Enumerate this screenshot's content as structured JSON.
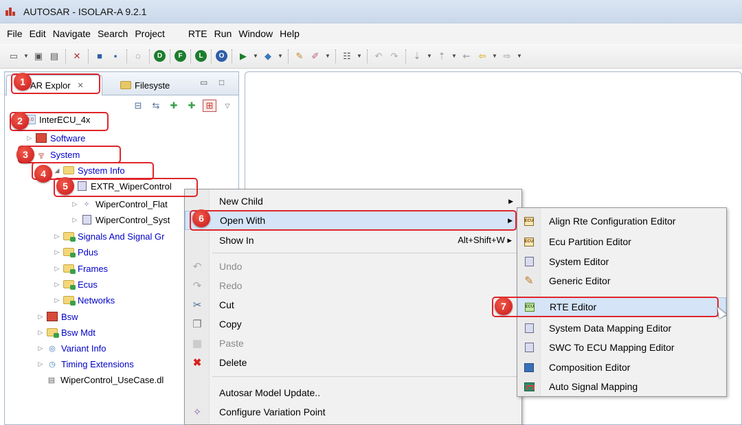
{
  "window": {
    "title": "AUTOSAR - ISOLAR-A 9.2.1"
  },
  "menubar": [
    "File",
    "Edit",
    "Navigate",
    "Search",
    "Project",
    "RTE",
    "Run",
    "Window",
    "Help"
  ],
  "toolbar": {
    "round_buttons": [
      "D",
      "F",
      "L",
      "O"
    ]
  },
  "left_panel": {
    "tabs": [
      {
        "label": "AR Explor",
        "close": "✕"
      },
      {
        "label": "Filesyste"
      }
    ],
    "tree": [
      {
        "label": "InterECU_4x"
      },
      {
        "label": "Software"
      },
      {
        "label": "System"
      },
      {
        "label": "System Info"
      },
      {
        "label": "EXTR_WiperControl"
      },
      {
        "label": "WiperControl_Flat"
      },
      {
        "label": "WiperControl_Syst"
      },
      {
        "label": "Signals And Signal Gr"
      },
      {
        "label": "Pdus"
      },
      {
        "label": "Frames"
      },
      {
        "label": "Ecus"
      },
      {
        "label": "Networks"
      },
      {
        "label": "Bsw"
      },
      {
        "label": "Bsw Mdt"
      },
      {
        "label": "Variant Info"
      },
      {
        "label": "Timing Extensions"
      },
      {
        "label": "WiperControl_UseCase.dl"
      }
    ]
  },
  "context_menu": [
    {
      "label": "New Child",
      "submenu": true
    },
    {
      "label": "Open With",
      "submenu": true,
      "highlight": true
    },
    {
      "label": "Show In",
      "shortcut": "Alt+Shift+W ▸"
    },
    {
      "label": "Undo",
      "disabled": true
    },
    {
      "label": "Redo",
      "disabled": true
    },
    {
      "label": "Cut"
    },
    {
      "label": "Copy"
    },
    {
      "label": "Paste",
      "disabled": true
    },
    {
      "label": "Delete"
    },
    {
      "label": "Autosar Model Update.."
    },
    {
      "label": "Configure Variation Point"
    }
  ],
  "submenu": [
    {
      "label": "Align Rte Configuration Editor"
    },
    {
      "label": "Ecu Partition Editor"
    },
    {
      "label": "System Editor"
    },
    {
      "label": "Generic Editor"
    },
    {
      "label": "RTE Editor",
      "highlight": true
    },
    {
      "label": "System Data Mapping Editor"
    },
    {
      "label": "SWC To ECU Mapping Editor"
    },
    {
      "label": "Composition Editor"
    },
    {
      "label": "Auto Signal Mapping"
    }
  ],
  "callouts": [
    "1",
    "2",
    "3",
    "4",
    "5",
    "6",
    "7"
  ],
  "colors": {
    "callout": "#e0252b",
    "tree_link": "#0000c8",
    "menu_highlight": "#d5e4f7"
  }
}
